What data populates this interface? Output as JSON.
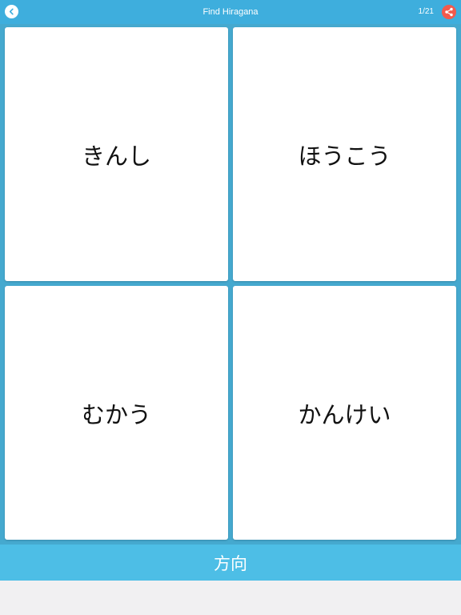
{
  "header": {
    "title": "Find Hiragana",
    "counter": "1/21",
    "back_icon": "chevron-left-icon",
    "share_icon": "share-icon"
  },
  "cards": [
    {
      "label": "きんし"
    },
    {
      "label": "ほうこう"
    },
    {
      "label": "むかう"
    },
    {
      "label": "かんけい"
    }
  ],
  "prompt": {
    "text": "方向"
  },
  "colors": {
    "header_bg": "#3eaedd",
    "board_bg": "#45a9cf",
    "prompt_bg": "#4dbee6",
    "share_bg": "#f25a4d",
    "page_bg": "#f1f0f2"
  }
}
